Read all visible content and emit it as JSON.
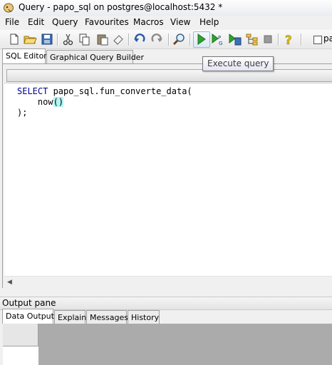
{
  "window": {
    "title": "Query - papo_sql on postgres@localhost:5432 *"
  },
  "menu": [
    "File",
    "Edit",
    "Query",
    "Favourites",
    "Macros",
    "View",
    "Help"
  ],
  "toolbar": {
    "icons": [
      "new-file-icon",
      "open-folder-icon",
      "save-icon",
      "cut-icon",
      "copy-icon",
      "paste-icon",
      "clear-icon",
      "undo-icon",
      "redo-icon",
      "find-icon",
      "execute-query-icon",
      "execute-pgscript-icon",
      "execute-to-file-icon",
      "explain-query-icon",
      "stop-icon",
      "help-icon"
    ],
    "checkbox_label": "pa"
  },
  "editor_tabs": [
    "SQL Editor",
    "Graphical Query Builder"
  ],
  "tooltip": "Execute query",
  "code": {
    "keyword": "SELECT",
    "line1_rest": " papo_sql.fun_converte_data(",
    "line2_indent": "    ",
    "line2_func": "now",
    "line2_parens": "()",
    "line3": ");"
  },
  "output_pane": {
    "title": "Output pane",
    "tabs": [
      "Data Output",
      "Explain",
      "Messages",
      "History"
    ]
  },
  "colors": {
    "keyword": "#00008b",
    "paren_highlight": "#b5f3f3",
    "grid_background": "#ababab"
  }
}
